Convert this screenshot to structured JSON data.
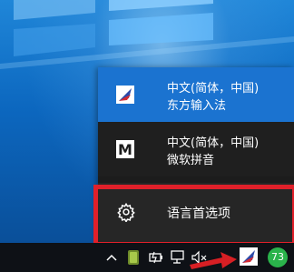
{
  "ime_menu": {
    "items": [
      {
        "line1": "中文(简体，中国)",
        "line2": "东方输入法",
        "icon": "dongfang-ime-icon"
      },
      {
        "line1": "中文(简体，中国)",
        "line2": "微软拼音",
        "icon": "microsoft-ime-icon"
      }
    ],
    "microsoft_ime_glyph": "M",
    "language_preferences_label": "语言首选项"
  },
  "taskbar": {
    "notification_count": "73",
    "icons": [
      "chevron-up-icon",
      "app-tray-icon",
      "power-icon",
      "network-icon",
      "volume-muted-icon",
      "ime-indicator-icon",
      "notification-badge"
    ]
  },
  "colors": {
    "selected_item": "#1b73d0",
    "highlight_box": "#e0202a",
    "badge": "#2ab34b"
  }
}
